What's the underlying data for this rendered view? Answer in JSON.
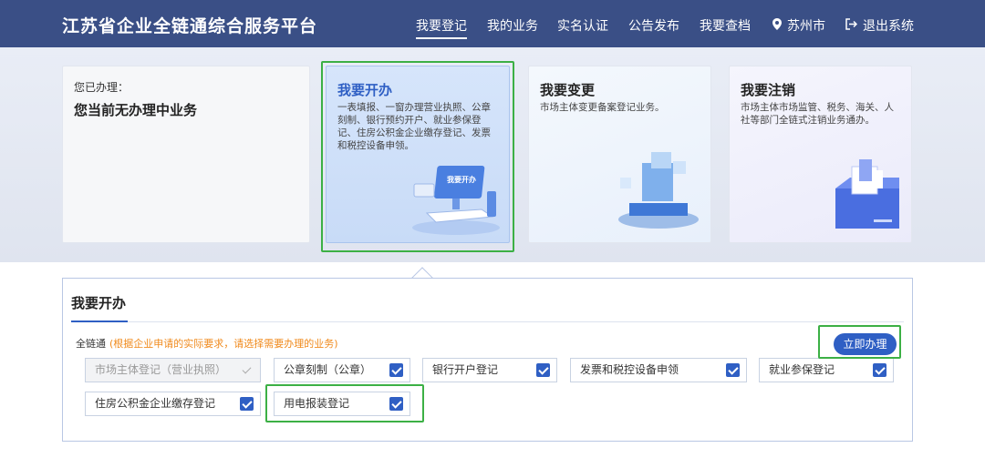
{
  "header": {
    "title": "江苏省企业全链通综合服务平台",
    "nav": [
      {
        "label": "我要登记",
        "active": true
      },
      {
        "label": "我的业务"
      },
      {
        "label": "实名认证"
      },
      {
        "label": "公告发布"
      },
      {
        "label": "我要查档"
      },
      {
        "label": "苏州市",
        "icon": "location-pin-icon"
      },
      {
        "label": "退出系统",
        "icon": "logout-icon"
      }
    ]
  },
  "status_card": {
    "sub": "您已办理：",
    "main": "您当前无办理中业务"
  },
  "cards": [
    {
      "title": "我要开办",
      "desc": "一表填报、一窗办理营业执照、公章刻制、银行预约开户、就业参保登记、住房公积金企业缴存登记、发票和税控设备申领。",
      "badge": "我要开办"
    },
    {
      "title": "我要变更",
      "desc": "市场主体变更备案登记业务。"
    },
    {
      "title": "我要注销",
      "desc": "市场主体市场监管、税务、海关、人社等部门全链式注销业务通办。"
    }
  ],
  "panel": {
    "title": "我要开办",
    "chain_label": "全链通",
    "chain_hint": "(根据企业申请的实际要求，请选择需要办理的业务)",
    "apply_label": "立即办理",
    "options": [
      {
        "label": "市场主体登记（营业执照）",
        "checked": true,
        "disabled": true
      },
      {
        "label": "公章刻制（公章）",
        "checked": true
      },
      {
        "label": "银行开户登记",
        "checked": true
      },
      {
        "label": "发票和税控设备申领",
        "checked": true
      },
      {
        "label": "就业参保登记",
        "checked": true
      },
      {
        "label": "住房公积金企业缴存登记",
        "checked": true
      },
      {
        "label": "用电报装登记",
        "checked": true
      }
    ]
  },
  "colors": {
    "header_bg": "#3a4f86",
    "accent": "#2f5fc4",
    "highlight": "#3cb045",
    "hint": "#f08a1c"
  }
}
